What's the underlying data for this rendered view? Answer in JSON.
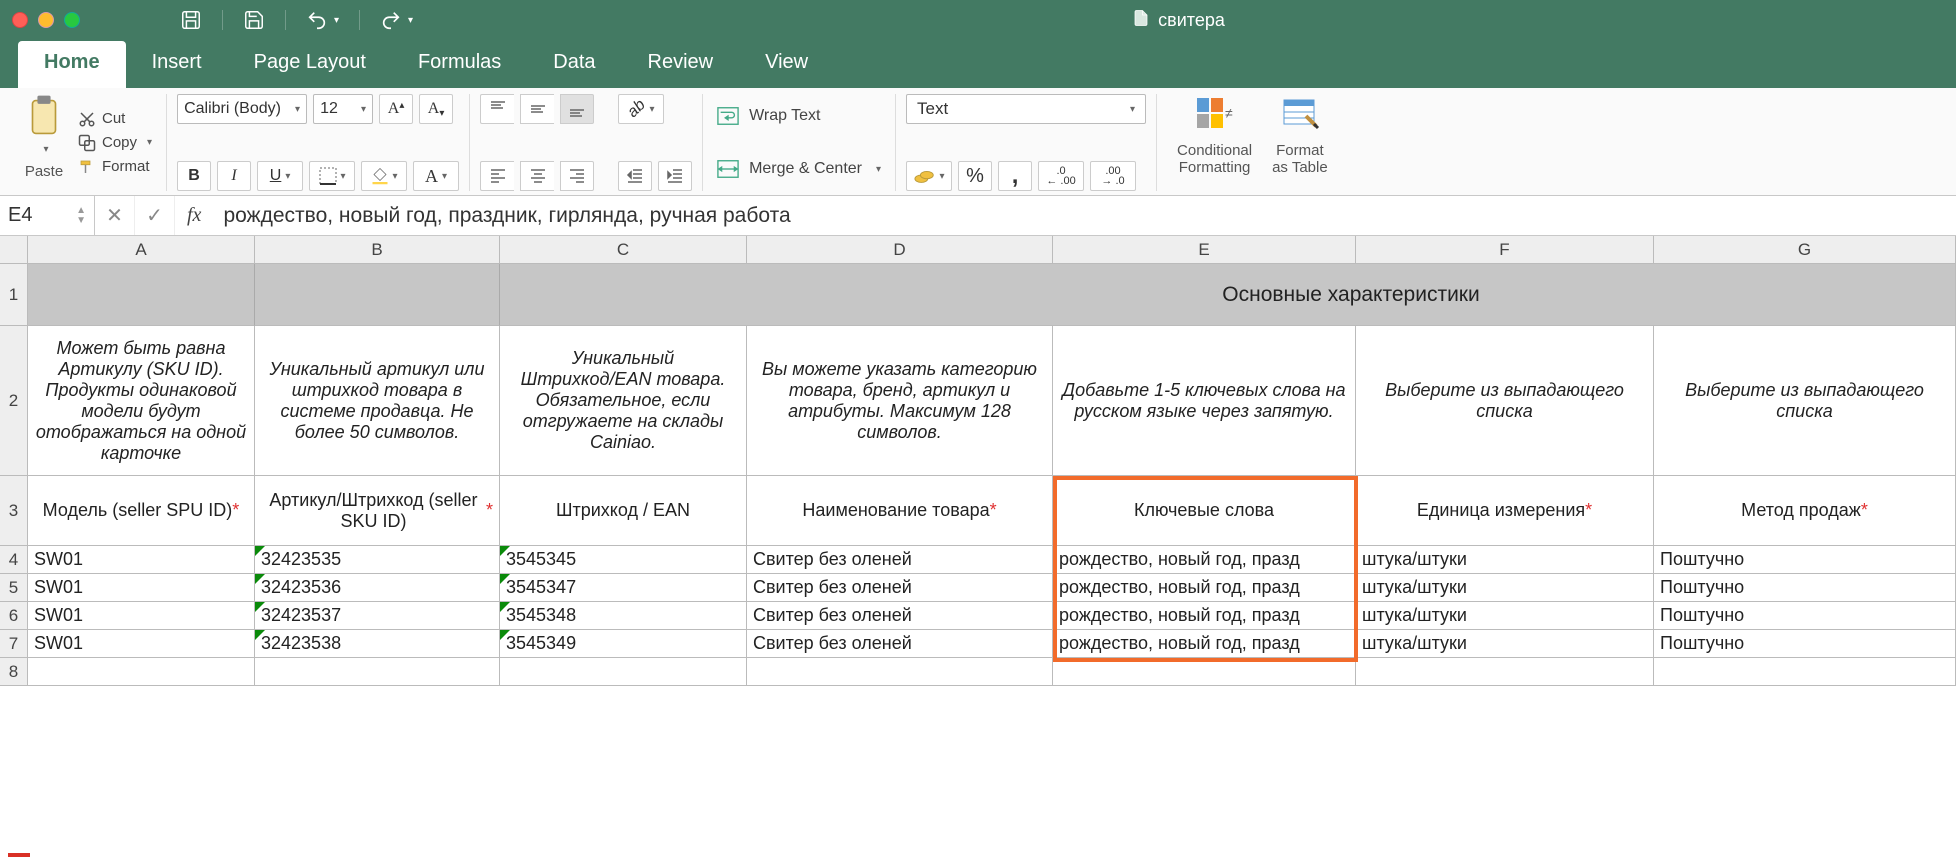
{
  "app": {
    "document_name": "свитера"
  },
  "ribbon": {
    "tabs": [
      "Home",
      "Insert",
      "Page Layout",
      "Formulas",
      "Data",
      "Review",
      "View"
    ],
    "active_tab": "Home",
    "clipboard": {
      "cut": "Cut",
      "copy": "Copy",
      "format": "Format",
      "paste": "Paste"
    },
    "font": {
      "name": "Calibri (Body)",
      "size": "12",
      "bold": "B",
      "italic": "I",
      "underline": "U"
    },
    "alignment": {
      "wrap": "Wrap Text",
      "merge": "Merge & Center"
    },
    "number": {
      "format": "Text",
      "percent": "%",
      "comma": ",",
      "inc_dec_1": ".0",
      "inc_dec_2": ".00"
    },
    "styles": {
      "cond": "Conditional Formatting",
      "fmt": "Format as Table"
    }
  },
  "formula_bar": {
    "cell_ref": "E4",
    "formula": "рождество, новый год, праздник, гирлянда, ручная работа"
  },
  "sheet": {
    "merged_header": "Основные характеристики",
    "columns": [
      "A",
      "B",
      "C",
      "D",
      "E",
      "F",
      "G"
    ],
    "row2": {
      "A": "Может быть равна Артикулу (SKU ID). Продукты одинаковой модели будут отображаться на одной карточке",
      "B": "Уникальный артикул или штрихкод товара в системе продавца. Не более 50 символов.",
      "C": "Уникальный Штрихкод/EAN товара. Обязательное, если отгружаете на склады Cainiao.",
      "D": "Вы можете указать категорию товара, бренд, артикул и атрибуты. Максимум 128 символов.",
      "E": "Добавьте 1-5 ключевых слова на русском языке через запятую.",
      "F": "Выберите из выпадающего списка",
      "G": "Выберите из выпадающего списка"
    },
    "row3": {
      "A": "Модель (seller SPU ID)",
      "A_req": true,
      "B": "Артикул/Штрихкод (seller SKU ID)",
      "B_req": true,
      "C": "Штрихкод  / EAN",
      "C_req": false,
      "D": "Наименование товара",
      "D_req": true,
      "E": "Ключевые слова",
      "E_req": false,
      "F": "Единица измерения",
      "F_req": true,
      "G": "Метод продаж",
      "G_req": true
    },
    "data_rows": [
      {
        "n": "4",
        "A": "SW01",
        "B": "32423535",
        "C": "3545345",
        "D": "Свитер без оленей",
        "E": "рождество, новый год, празд",
        "F": "штука/штуки",
        "G": "Поштучно"
      },
      {
        "n": "5",
        "A": "SW01",
        "B": "32423536",
        "C": "3545347",
        "D": "Свитер без оленей",
        "E": "рождество, новый год, празд",
        "F": "штука/штуки",
        "G": "Поштучно"
      },
      {
        "n": "6",
        "A": "SW01",
        "B": "32423537",
        "C": "3545348",
        "D": "Свитер без оленей",
        "E": "рождество, новый год, празд",
        "F": "штука/штуки",
        "G": "Поштучно"
      },
      {
        "n": "7",
        "A": "SW01",
        "B": "32423538",
        "C": "3545349",
        "D": "Свитер без оленей",
        "E": "рождество, новый год, празд",
        "F": "штука/штуки",
        "G": "Поштучно"
      }
    ]
  }
}
